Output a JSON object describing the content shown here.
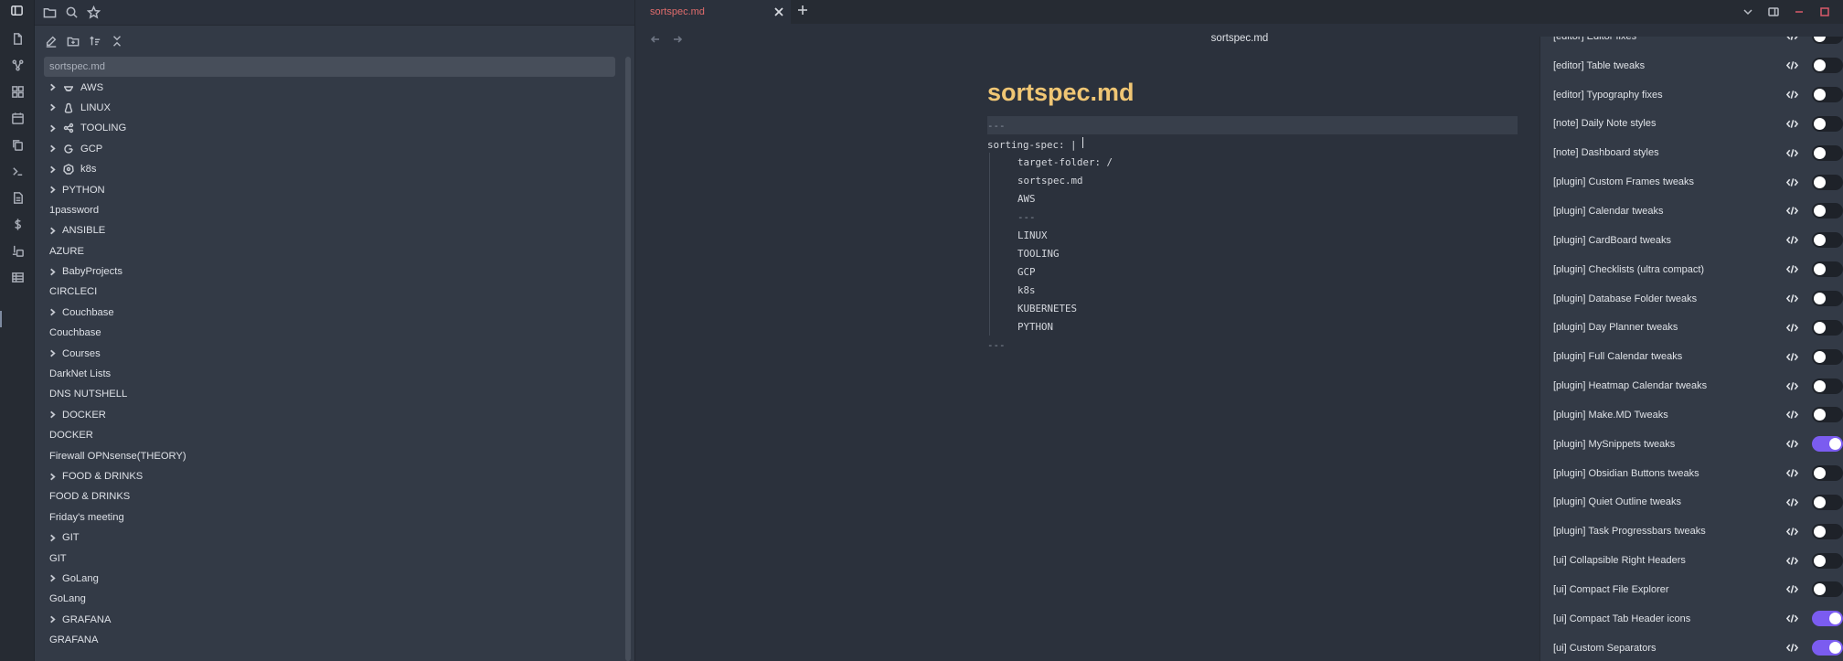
{
  "ribbon": {
    "icons": [
      "sidebar-toggle-icon",
      "file-icon",
      "graph-icon",
      "grid-icon",
      "calendar-icon",
      "copy-icon",
      "terminal-icon",
      "document-icon",
      "dollar-icon",
      "dice-icon",
      "table-icon"
    ]
  },
  "sidebar": {
    "header_icons": [
      "folder-icon",
      "search-icon",
      "star-icon"
    ],
    "toolbar_icons": [
      "new-note-icon",
      "new-folder-icon",
      "sort-icon",
      "collapse-icon"
    ],
    "items": [
      {
        "label": "sortspec.md",
        "type": "file",
        "selected": true
      },
      {
        "label": "AWS",
        "type": "folder",
        "icon": "aws-icon"
      },
      {
        "label": "LINUX",
        "type": "folder",
        "icon": "linux-icon"
      },
      {
        "label": "TOOLING",
        "type": "folder",
        "icon": "tooling-icon"
      },
      {
        "label": "GCP",
        "type": "folder",
        "icon": "gcp-icon"
      },
      {
        "label": "k8s",
        "type": "folder",
        "icon": "kubernetes-icon"
      },
      {
        "label": "PYTHON",
        "type": "folder"
      },
      {
        "label": "1password",
        "type": "file"
      },
      {
        "label": "ANSIBLE",
        "type": "folder"
      },
      {
        "label": "AZURE",
        "type": "file"
      },
      {
        "label": "BabyProjects",
        "type": "folder"
      },
      {
        "label": "CIRCLECI",
        "type": "file"
      },
      {
        "label": "Couchbase",
        "type": "folder"
      },
      {
        "label": "Couchbase",
        "type": "file"
      },
      {
        "label": "Courses",
        "type": "folder"
      },
      {
        "label": "DarkNet Lists",
        "type": "file"
      },
      {
        "label": "DNS NUTSHELL",
        "type": "file"
      },
      {
        "label": "DOCKER",
        "type": "folder"
      },
      {
        "label": "DOCKER",
        "type": "file"
      },
      {
        "label": "Firewall OPNsense(THEORY)",
        "type": "file"
      },
      {
        "label": "FOOD & DRINKS",
        "type": "folder"
      },
      {
        "label": "FOOD & DRINKS",
        "type": "file"
      },
      {
        "label": "Friday's meeting",
        "type": "file"
      },
      {
        "label": "GIT",
        "type": "folder"
      },
      {
        "label": "GIT",
        "type": "file"
      },
      {
        "label": "GoLang",
        "type": "folder"
      },
      {
        "label": "GoLang",
        "type": "file"
      },
      {
        "label": "GRAFANA",
        "type": "folder"
      },
      {
        "label": "GRAFANA",
        "type": "file"
      }
    ]
  },
  "tabs": [
    {
      "label": "sortspec.md",
      "active": true
    }
  ],
  "view": {
    "title": "sortspec.md"
  },
  "note": {
    "heading": "sortspec.md",
    "lines": [
      {
        "text": "---",
        "indent": false,
        "highlight": true,
        "dim": true
      },
      {
        "text": "sorting-spec: |",
        "indent": false,
        "caret": true
      },
      {
        "text": "target-folder: /",
        "indent": true
      },
      {
        "text": "sortspec.md",
        "indent": true
      },
      {
        "text": "AWS",
        "indent": true
      },
      {
        "text": "---",
        "indent": true,
        "dim": true
      },
      {
        "text": "LINUX",
        "indent": true
      },
      {
        "text": "TOOLING",
        "indent": true
      },
      {
        "text": "GCP",
        "indent": true
      },
      {
        "text": "k8s",
        "indent": true
      },
      {
        "text": "KUBERNETES",
        "indent": true
      },
      {
        "text": "PYTHON",
        "indent": true
      },
      {
        "text": "---",
        "indent": false,
        "dim": true
      }
    ]
  },
  "style_settings": {
    "accent_color": "#7b5cf0",
    "items": [
      {
        "label": "[editor] Editor fixes",
        "on": false
      },
      {
        "label": "[editor] Table tweaks",
        "on": false
      },
      {
        "label": "[editor] Typography fixes",
        "on": false
      },
      {
        "label": "[note] Daily Note styles",
        "on": false
      },
      {
        "label": "[note] Dashboard styles",
        "on": false
      },
      {
        "label": "[plugin] Custom Frames tweaks",
        "on": false
      },
      {
        "label": "[plugin] Calendar tweaks",
        "on": false
      },
      {
        "label": "[plugin] CardBoard tweaks",
        "on": false
      },
      {
        "label": "[plugin] Checklists (ultra compact)",
        "on": false
      },
      {
        "label": "[plugin] Database Folder tweaks",
        "on": false
      },
      {
        "label": "[plugin] Day Planner tweaks",
        "on": false
      },
      {
        "label": "[plugin] Full Calendar tweaks",
        "on": false
      },
      {
        "label": "[plugin] Heatmap Calendar tweaks",
        "on": false
      },
      {
        "label": "[plugin] Make.MD Tweaks",
        "on": false
      },
      {
        "label": "[plugin] MySnippets tweaks",
        "on": true
      },
      {
        "label": "[plugin] Obsidian Buttons tweaks",
        "on": false
      },
      {
        "label": "[plugin] Quiet Outline tweaks",
        "on": false
      },
      {
        "label": "[plugin] Task Progressbars tweaks",
        "on": false
      },
      {
        "label": "[ui] Collapsible Right Headers",
        "on": false
      },
      {
        "label": "[ui] Compact File Explorer",
        "on": false
      },
      {
        "label": "[ui] Compact Tab Header icons",
        "on": true
      },
      {
        "label": "[ui] Custom Separators",
        "on": true
      }
    ]
  }
}
